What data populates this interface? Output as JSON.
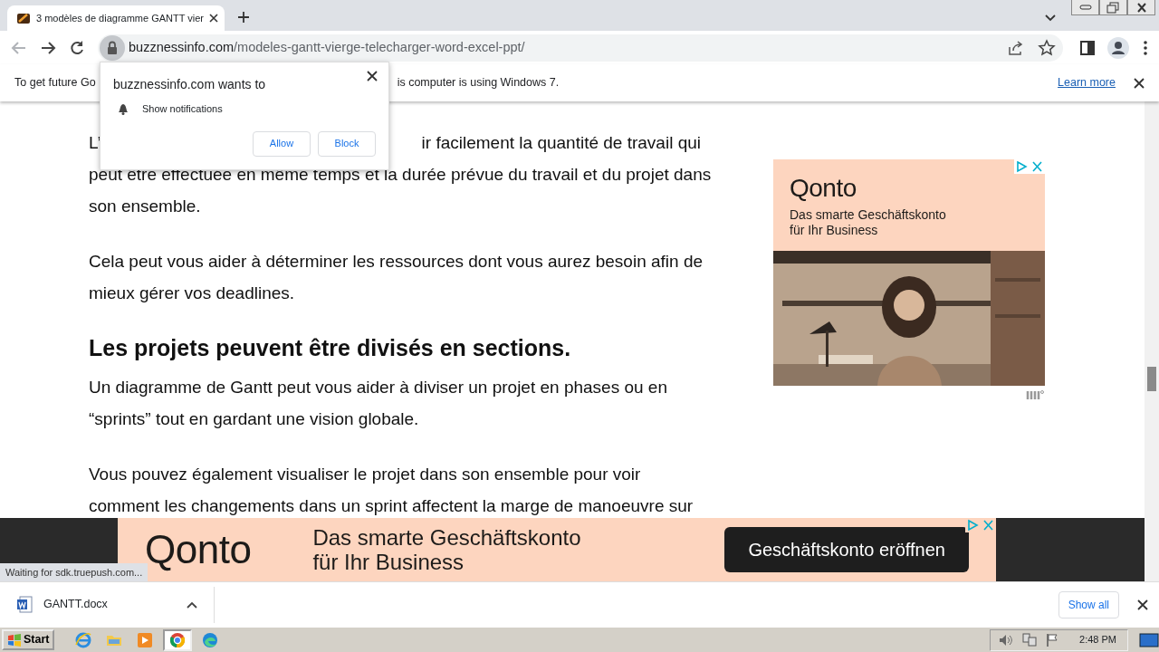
{
  "tabs": [
    {
      "title": "3 modèles de diagramme GANTT vier",
      "selected": true
    }
  ],
  "nav": {
    "back_disabled": true,
    "forward_disabled": false
  },
  "address": {
    "domain": "buzznessinfo.com",
    "path": "/modeles-gantt-vierge-telecharger-word-excel-ppt/"
  },
  "infobar": {
    "message_start": "To get future Go",
    "message_end": "is computer is using Windows 7.",
    "link": "Learn more"
  },
  "permission_popup": {
    "title": "buzznessinfo.com wants to",
    "permission": "Show notifications",
    "buttons": [
      "Allow",
      "Block"
    ]
  },
  "article": [
    {
      "kind": "covered",
      "visible_start": "L’",
      "visible_end": "ir facilement la quantité de travail qui",
      "rest": "peut être effectuée en même temps et la durée prévue du travail et du projet dans son ensemble."
    },
    {
      "kind": "paragraph",
      "text": "Cela peut vous aider à déterminer les ressources dont vous aurez besoin afin de mieux gérer vos deadlines."
    },
    {
      "kind": "heading",
      "text": "Les projets peuvent être divisés en sections."
    },
    {
      "kind": "paragraph",
      "text": "Un diagramme de Gantt peut vous aider à diviser un projet en phases ou en “sprints” tout en gardant une vision globale."
    },
    {
      "kind": "paragraph",
      "text": "Vous pouvez également visualiser le projet dans son ensemble pour voir comment les changements dans un sprint affectent la marge de manoeuvre sur"
    }
  ],
  "side_ad": {
    "logo": "Qonto",
    "tagline": "Das smarte Geschäftskonto für Ihr Business"
  },
  "bottom_ad": {
    "logo": "Qonto",
    "tagline": "Das smarte Geschäftskonto für Ihr Business",
    "button": "Geschäftskonto eröffnen"
  },
  "status": "Waiting for sdk.truepush.com...",
  "downloads": {
    "items": [
      {
        "name": "GANTT.docx"
      }
    ],
    "show_all": "Show all"
  },
  "taskbar": {
    "start": "Start",
    "apps": [
      {
        "kind": "ie",
        "selected": false
      },
      {
        "kind": "folder",
        "selected": false
      },
      {
        "kind": "media",
        "selected": false
      },
      {
        "kind": "chrome",
        "selected": true
      },
      {
        "kind": "edge",
        "selected": false
      }
    ],
    "time": "2:48 PM"
  }
}
